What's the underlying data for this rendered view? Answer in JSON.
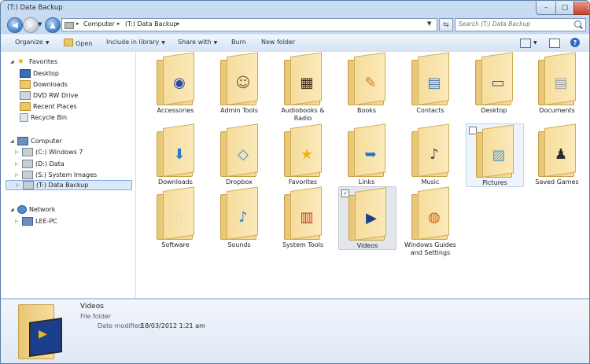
{
  "window": {
    "title": "(T:) Data Backup"
  },
  "caption": {
    "minimize": "–",
    "maximize": "▢",
    "close": "✕"
  },
  "nav": {
    "address": [
      {
        "label": "Computer"
      },
      {
        "label": "(T:) Data Backup"
      }
    ],
    "search_placeholder": "Search (T:) Data Backup"
  },
  "toolbar": {
    "organize": "Organize",
    "open": "Open",
    "include": "Include in library",
    "share": "Share with",
    "burn": "Burn",
    "new_folder": "New folder"
  },
  "sidebar": {
    "favorites_header": "Favorites",
    "favorites": [
      "Desktop",
      "Downloads",
      "DVD RW Drive",
      "Recent Places",
      "Recycle Bin"
    ],
    "computer_header": "Computer",
    "drives": [
      "(C:) Windows 7",
      "(D:) Data",
      "(S:) System Images",
      "(T:) Data Backup"
    ],
    "network_header": "Network",
    "network": [
      "LEE-PC"
    ]
  },
  "items": [
    {
      "label": "Accessories",
      "emblem": "disc-emblem",
      "accent": "#2b4aa3"
    },
    {
      "label": "Admin Tools",
      "emblem": "user-emblem",
      "accent": "#7a5a3c"
    },
    {
      "label": "Audiobooks & Radio",
      "emblem": "film-emblem",
      "accent": "#3a2a1a"
    },
    {
      "label": "Books",
      "emblem": "book-emblem",
      "accent": "#e07a1c"
    },
    {
      "label": "Contacts",
      "emblem": "contact-card-emblem",
      "accent": "#4a7dbf"
    },
    {
      "label": "Desktop",
      "emblem": "monitor-emblem",
      "accent": "#2a5da8"
    },
    {
      "label": "Documents",
      "emblem": "document-emblem",
      "accent": "#9aa3ad"
    },
    {
      "label": "Downloads",
      "emblem": "download-arrow-emblem",
      "accent": "#1f7bd6"
    },
    {
      "label": "Dropbox",
      "emblem": "dropbox-emblem",
      "accent": "#2a8ee4"
    },
    {
      "label": "Favorites",
      "emblem": "star-emblem",
      "accent": "#f0b020"
    },
    {
      "label": "Links",
      "emblem": "link-arrow-emblem",
      "accent": "#1c75d0"
    },
    {
      "label": "Music",
      "emblem": "music-note-emblem",
      "accent": "#4b4b4b"
    },
    {
      "label": "Pictures",
      "emblem": "landscape-emblem",
      "accent": "#5b9ac8"
    },
    {
      "label": "Saved Games",
      "emblem": "chess-piece-emblem",
      "accent": "#2b2b2b"
    },
    {
      "label": "Software",
      "emblem": "pages-emblem",
      "accent": "#d8d8d8"
    },
    {
      "label": "Sounds",
      "emblem": "music-note-emblem",
      "accent": "#1a88d8"
    },
    {
      "label": "System Tools",
      "emblem": "chart-emblem",
      "accent": "#c33a2a"
    },
    {
      "label": "Videos",
      "emblem": "film-strip-emblem",
      "accent": "#1c3f8c"
    },
    {
      "label": "Windows Guides and Settings",
      "emblem": "browser-emblem",
      "accent": "#d85a1a"
    }
  ],
  "details": {
    "name": "Videos",
    "type": "File folder",
    "modified_label": "Date modified:",
    "modified_value": "18/03/2012 1:21 am"
  }
}
